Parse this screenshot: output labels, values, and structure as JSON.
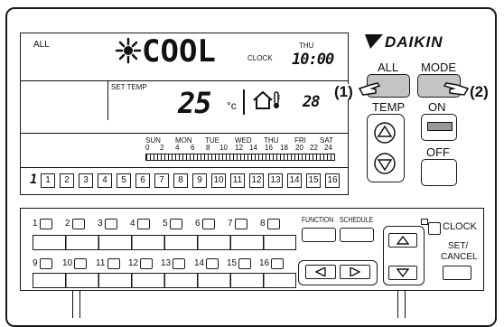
{
  "lcd": {
    "all_label": "ALL",
    "mode_text": "COOL",
    "clock_label": "CLOCK",
    "day_label": "THU",
    "time_value": "10:00",
    "set_temp_label": "SET TEMP",
    "set_temp_value": "25",
    "temp_unit": "°c",
    "room_temp_value": "28",
    "zone_prefix": "1",
    "days": [
      "SUN",
      "MON",
      "TUE",
      "WED",
      "THU",
      "FRI",
      "SAT"
    ],
    "hours": [
      "0",
      "2",
      "4",
      "6",
      "8",
      "10",
      "12",
      "14",
      "16",
      "18",
      "20",
      "22",
      "24"
    ],
    "zones": [
      "1",
      "2",
      "3",
      "4",
      "5",
      "6",
      "7",
      "8",
      "9",
      "10",
      "11",
      "12",
      "13",
      "14",
      "15",
      "16"
    ]
  },
  "brand": "DAIKIN",
  "buttons": {
    "all": "ALL",
    "mode": "MODE",
    "temp": "TEMP",
    "on": "ON",
    "off": "OFF",
    "function": "FUNCTION",
    "schedule": "SCHEDULE",
    "clock": "CLOCK",
    "set_cancel_1": "SET/",
    "set_cancel_2": "CANCEL"
  },
  "callouts": {
    "c1": "(1)",
    "c2": "(2)"
  },
  "zone_buttons_row1": [
    "1",
    "2",
    "3",
    "4",
    "5",
    "6",
    "7",
    "8"
  ],
  "zone_buttons_row2": [
    "9",
    "10",
    "11",
    "12",
    "13",
    "14",
    "15",
    "16"
  ],
  "icons": [
    "fan-icon",
    "house-icon",
    "thermometer-icon",
    "up-arrow-icon",
    "down-arrow-icon",
    "left-arrow-icon",
    "right-arrow-icon",
    "hand-pointer-icon"
  ]
}
